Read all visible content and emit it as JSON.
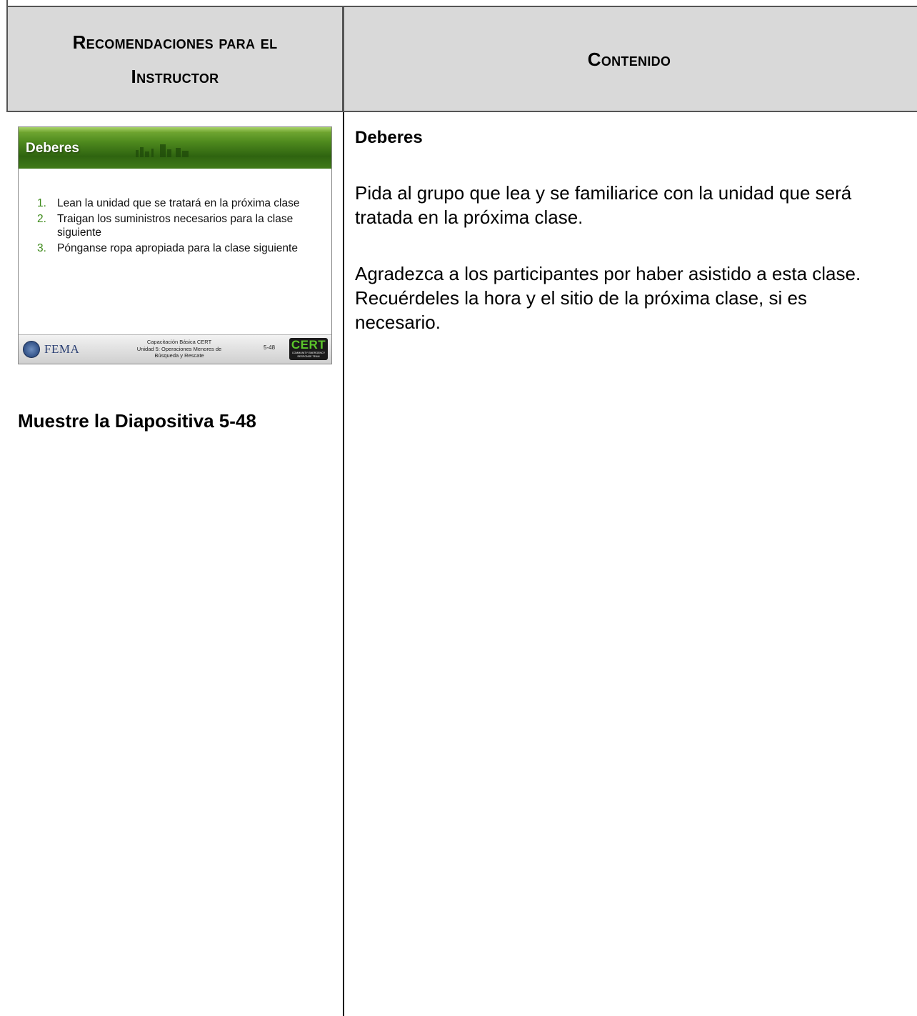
{
  "header": {
    "left_title_line1": "Recomendaciones para el",
    "left_title_line2": "Instructor",
    "right_title": "Contenido"
  },
  "slide": {
    "title": "Deberes",
    "items": [
      {
        "num": "1.",
        "text": "Lean la unidad que se tratará en la próxima clase"
      },
      {
        "num": "2.",
        "text": "Traigan los suministros necesarios para la clase siguiente"
      },
      {
        "num": "3.",
        "text": "Pónganse ropa apropiada para la clase siguiente"
      }
    ],
    "footer": {
      "fema": "FEMA",
      "line1": "Capacitación Básica CERT",
      "line2": "Unidad 5: Operaciones Menores de",
      "line3": "Búsqueda y Rescate",
      "number": "5-48",
      "cert_logo": "CERT",
      "cert_sub": "COMMUNITY EMERGENCY RESPONSE TEAM"
    },
    "accent_color": "#3d8a1a"
  },
  "instructor_note": "Muestre la Diapositiva 5-48",
  "content": {
    "heading": "Deberes",
    "paragraph1": "Pida al grupo que lea y se familiarice con la unidad que será tratada en la próxima clase.",
    "paragraph2": "Agradezca a los participantes por haber asistido a esta clase.  Recuérdeles la hora y el sitio de la próxima clase, si es necesario."
  }
}
